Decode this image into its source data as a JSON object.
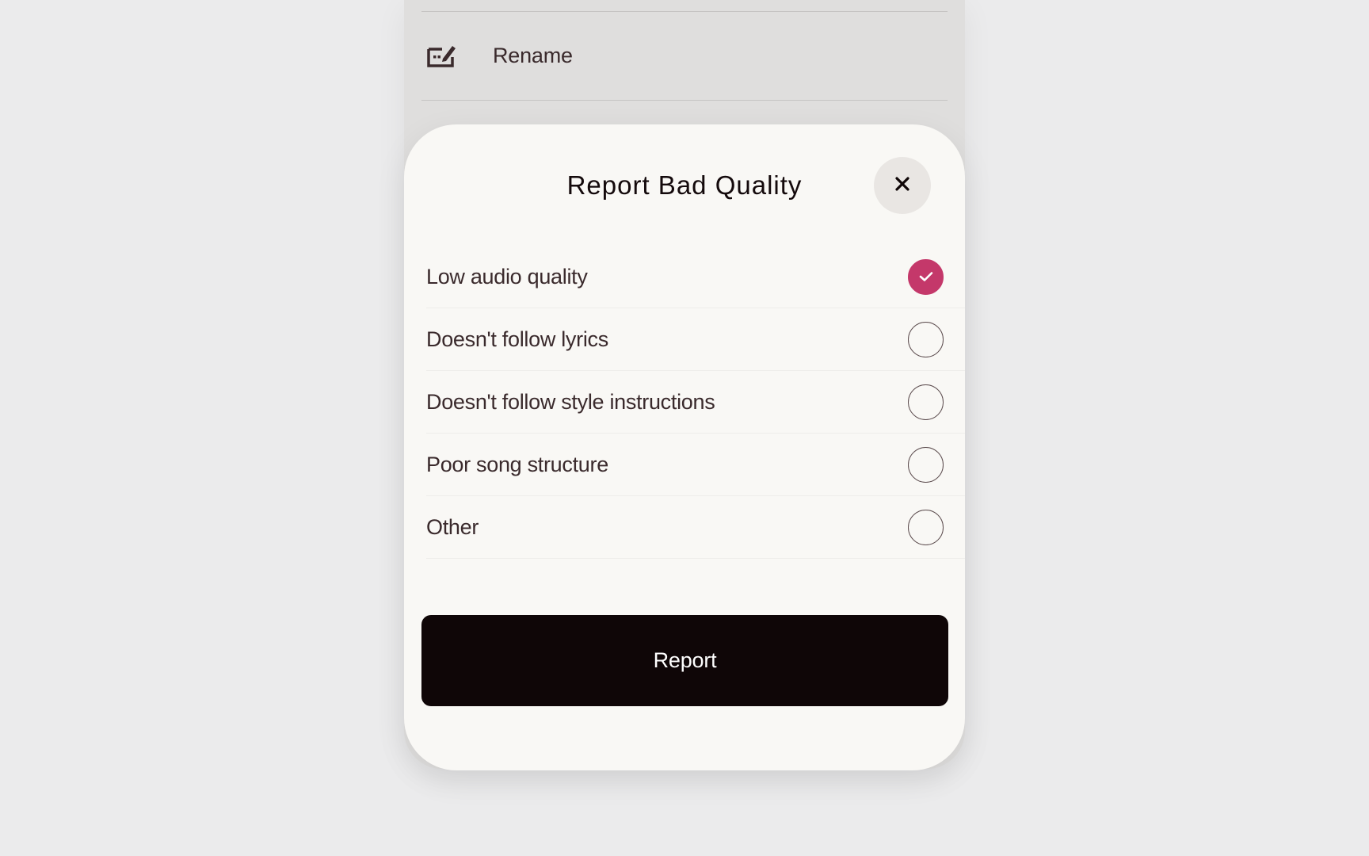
{
  "menu": {
    "rename_label": "Rename",
    "rename_icon": "edit-icon"
  },
  "dialog": {
    "title": "Report Bad Quality",
    "close_icon": "close-icon",
    "options": [
      {
        "label": "Low audio quality",
        "checked": true
      },
      {
        "label": "Doesn't follow lyrics",
        "checked": false
      },
      {
        "label": "Doesn't follow style instructions",
        "checked": false
      },
      {
        "label": "Poor song structure",
        "checked": false
      },
      {
        "label": "Other",
        "checked": false
      }
    ],
    "submit_label": "Report"
  },
  "colors": {
    "accent": "#c4386a",
    "button_bg": "#0f0607",
    "sheet_bg": "#f9f8f5",
    "backdrop": "#ebebec"
  }
}
